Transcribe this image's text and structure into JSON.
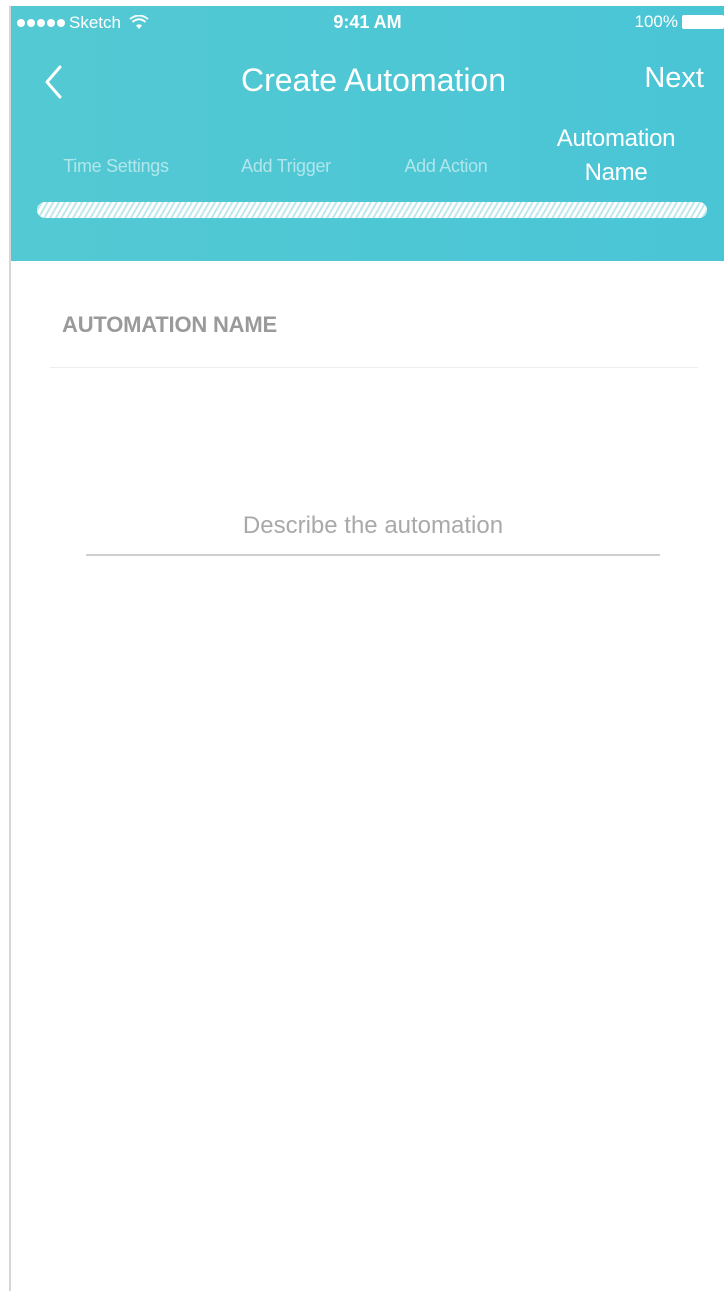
{
  "status_bar": {
    "carrier": "Sketch",
    "time": "9:41 AM",
    "battery": "100%"
  },
  "nav": {
    "title": "Create Automation",
    "next_label": "Next",
    "back_icon": "chevron-left-icon"
  },
  "steps": [
    {
      "label": "Time Settings",
      "active": false
    },
    {
      "label": "Add Trigger",
      "active": false
    },
    {
      "label": "Add Action",
      "active": false
    },
    {
      "label": "Automation Name",
      "active": true
    }
  ],
  "progress": {
    "value_percent": 100
  },
  "form": {
    "section_title": "AUTOMATION NAME",
    "name_value": "",
    "name_placeholder": "Describe the automation"
  },
  "colors": {
    "header": "#4ec7d5",
    "section_title": "#9a9a9a",
    "placeholder": "#a9a9a9"
  }
}
